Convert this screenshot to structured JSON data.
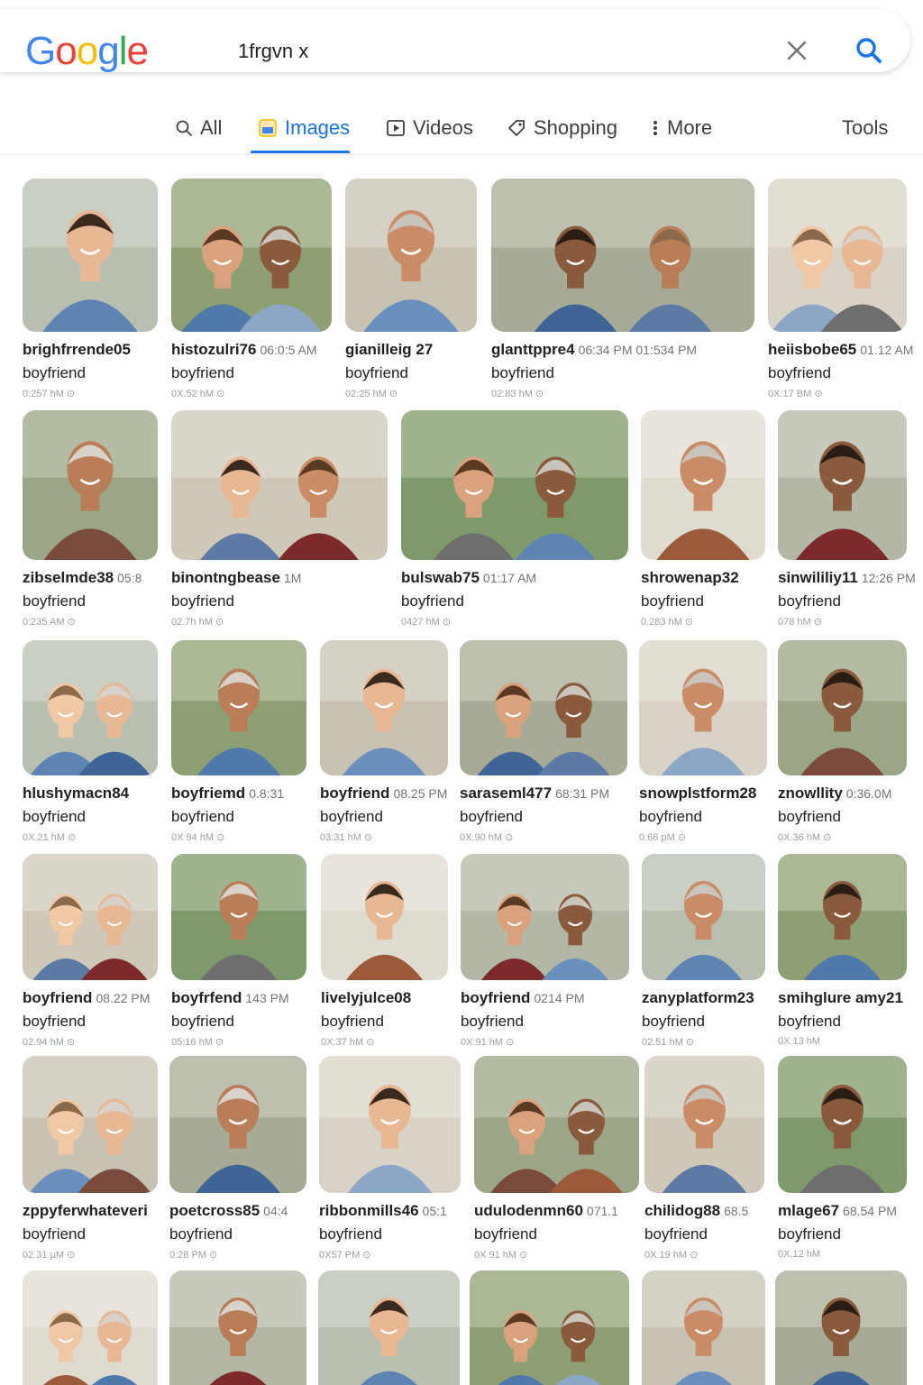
{
  "header": {
    "logo_text": "Google",
    "logo_colors": [
      "#4285F4",
      "#EA4335",
      "#FBBC05",
      "#4285F4",
      "#34A853",
      "#EA4335"
    ],
    "query": "1frgvn x",
    "clear_icon": "close-icon",
    "search_icon": "search-icon"
  },
  "tabs": [
    {
      "label": "All",
      "icon": "search-icon"
    },
    {
      "label": "Images",
      "icon": "image-icon",
      "active": true
    },
    {
      "label": "Videos",
      "icon": "play-icon"
    },
    {
      "label": "Shopping",
      "icon": "tag-icon"
    },
    {
      "label": "More",
      "icon": "more-vert-icon"
    },
    {
      "label": "Tools"
    }
  ],
  "results": [
    {
      "title": "brighfrrende05",
      "time": "",
      "sub": "boyfriend",
      "meta": "0:257 hM ⊙"
    },
    {
      "title": "histozulri76",
      "time": "06:0:5 AM",
      "sub": "boyfriend",
      "meta": "0X.52 hM ⊙"
    },
    {
      "title": "gianilleig 27",
      "time": "",
      "sub": "boyfriend",
      "meta": "02:25 hM ⊙"
    },
    {
      "title": "glanttppre4",
      "time": "06:34 PM    01:534 PM",
      "sub": "boyfriend",
      "meta": "02:83 hM ⊙"
    },
    {
      "title": "heiisbobe65",
      "time": "01.12 AM",
      "sub": "boyfriend",
      "meta": "0X:17 BM ⊙"
    },
    {
      "title": "zibselmde38",
      "time": "05:8",
      "sub": "boyfriend",
      "meta": "0:235 AM ⊙"
    },
    {
      "title": "binontngbease",
      "time": "1M",
      "sub": "boyfriend",
      "meta": "02.7h hM ⊙"
    },
    {
      "title": "bulswab75",
      "time": "01:17 AM",
      "sub": "boyfriend",
      "meta": "0427 hM ⊙"
    },
    {
      "title": "shrowenap32",
      "time": "",
      "sub": "boyfriend",
      "meta": "0.283 hM ⊙"
    },
    {
      "title": "sinwililiy11",
      "time": "12:26 PM",
      "sub": "boyfriend",
      "meta": "078 hM ⊙"
    },
    {
      "title": "hlushymacn84",
      "time": "",
      "sub": "boyfriend",
      "meta": "0X.21 hM ⊙"
    },
    {
      "title": "boyfriemd",
      "time": "0.8:31",
      "sub": "boyfriend",
      "meta": "0X 94 hM ⊙"
    },
    {
      "title": "boyfriend",
      "time": "08.25 PM",
      "sub": "boyfriend",
      "meta": "03:31 hM ⊙"
    },
    {
      "title": "saraseml477",
      "time": "68:31 PM",
      "sub": "boyfriend",
      "meta": "0X.90 hM ⊙"
    },
    {
      "title": "snowplstform28",
      "time": "",
      "sub": "boyfriend",
      "meta": "0:66 pM ⊙"
    },
    {
      "title": "znowllity",
      "time": "0:36.0M",
      "sub": "boyfriend",
      "meta": "0X.36 hM ⊙"
    },
    {
      "title": "boyfriend",
      "time": "08.22 PM",
      "sub": "boyfriend",
      "meta": "02.94 hM ⊙"
    },
    {
      "title": "boyfrfend",
      "time": "143 PM",
      "sub": "boyfriend",
      "meta": "05:16 hM ⊙"
    },
    {
      "title": "livelyjulce08",
      "time": "",
      "sub": "boyfriend",
      "meta": "0X:37 hM ⊙"
    },
    {
      "title": "boyfriend",
      "time": "0214 PM",
      "sub": "boyfriend",
      "meta": "0X:91 hM ⊙"
    },
    {
      "title": "zanyplatform23",
      "time": "",
      "sub": "boyfriend",
      "meta": "02.51 hM ⊙"
    },
    {
      "title": "smihglure amy21",
      "time": "",
      "sub": "boyfriend",
      "meta": "0X.13 hM"
    },
    {
      "title": "zppyferwhateveri",
      "time": "",
      "sub": "boyfriend",
      "meta": "02.31 μM ⊙"
    },
    {
      "title": "poetcross85",
      "time": "04:4",
      "sub": "boyfriend",
      "meta": "0:28 PM ⊙"
    },
    {
      "title": "ribbonmills46",
      "time": "05:1",
      "sub": "boyfriend",
      "meta": "0X57 PM ⊙"
    },
    {
      "title": "udulodenmn60",
      "time": "071.1",
      "sub": "boyfriend",
      "meta": "0X 91 hM ⊙"
    },
    {
      "title": "chilidog88",
      "time": "68.5",
      "sub": "boyfriend",
      "meta": "0X.19 hM ⊙"
    },
    {
      "title": "mlage67",
      "time": "68.54 PM",
      "sub": "boyfriend",
      "meta": "0X.12 hM"
    },
    {
      "title": "",
      "time": "",
      "sub": "",
      "meta": ""
    },
    {
      "title": "",
      "time": "",
      "sub": "",
      "meta": ""
    },
    {
      "title": "",
      "time": "",
      "sub": "",
      "meta": ""
    },
    {
      "title": "",
      "time": "",
      "sub": "",
      "meta": ""
    },
    {
      "title": "",
      "time": "",
      "sub": "",
      "meta": ""
    },
    {
      "title": "",
      "time": "",
      "sub": "",
      "meta": ""
    }
  ]
}
